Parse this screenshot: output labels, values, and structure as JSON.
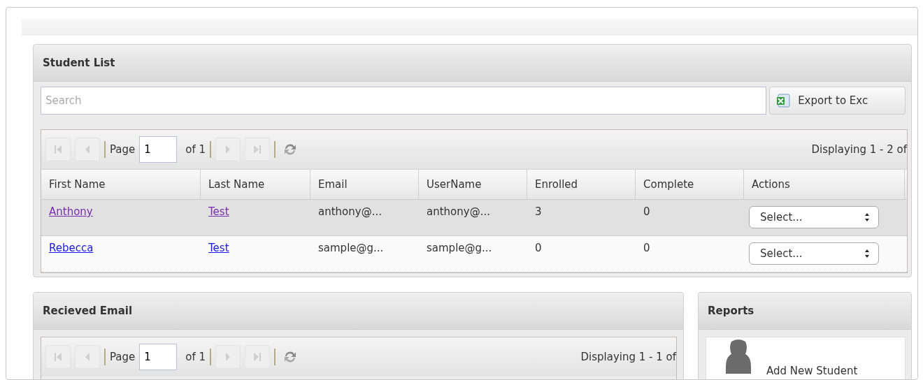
{
  "student_list": {
    "title": "Student List",
    "search": {
      "placeholder": "Search"
    },
    "export_button": "Export to Exc",
    "pager": {
      "page_label": "Page",
      "page": "1",
      "of": "of 1",
      "display": "Displaying 1 - 2 of",
      "first_disabled": true,
      "prev_disabled": true,
      "next_disabled": true,
      "last_disabled": true
    },
    "columns": [
      "First Name",
      "Last Name",
      "Email",
      "UserName",
      "Enrolled",
      "Complete",
      "Actions"
    ],
    "rows": [
      {
        "selected": true,
        "first_name": "Anthony",
        "last_name": "Test",
        "visited": true,
        "email": "anthony@...",
        "username": "anthony@...",
        "enrolled": "3",
        "complete": "0",
        "action": "Select..."
      },
      {
        "selected": false,
        "first_name": "Rebecca",
        "last_name": "Test",
        "visited": false,
        "email": "sample@g...",
        "username": "sample@g...",
        "enrolled": "0",
        "complete": "0",
        "action": "Select..."
      }
    ]
  },
  "received_email": {
    "title": "Recieved Email",
    "pager": {
      "page_label": "Page",
      "page": "1",
      "of": "of 1",
      "display": "Displaying 1 - 1 of",
      "first_disabled": true,
      "prev_disabled": true,
      "next_disabled": true,
      "last_disabled": true
    }
  },
  "reports": {
    "title": "Reports",
    "items": [
      "Add New Student"
    ]
  }
}
